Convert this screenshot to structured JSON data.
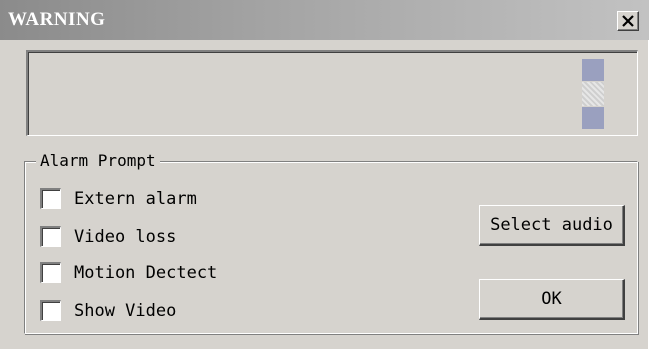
{
  "window": {
    "title": "WARNING",
    "close_icon": "close-x-icon"
  },
  "display": {
    "text": ""
  },
  "alarm_prompt": {
    "legend": "Alarm Prompt",
    "options": [
      {
        "label": "Extern alarm",
        "checked": false
      },
      {
        "label": "Video loss",
        "checked": false
      },
      {
        "label": "Motion Dectect",
        "checked": false
      },
      {
        "label": "Show Video",
        "checked": false
      }
    ]
  },
  "buttons": {
    "select_audio": "Select audio",
    "ok": "OK"
  }
}
